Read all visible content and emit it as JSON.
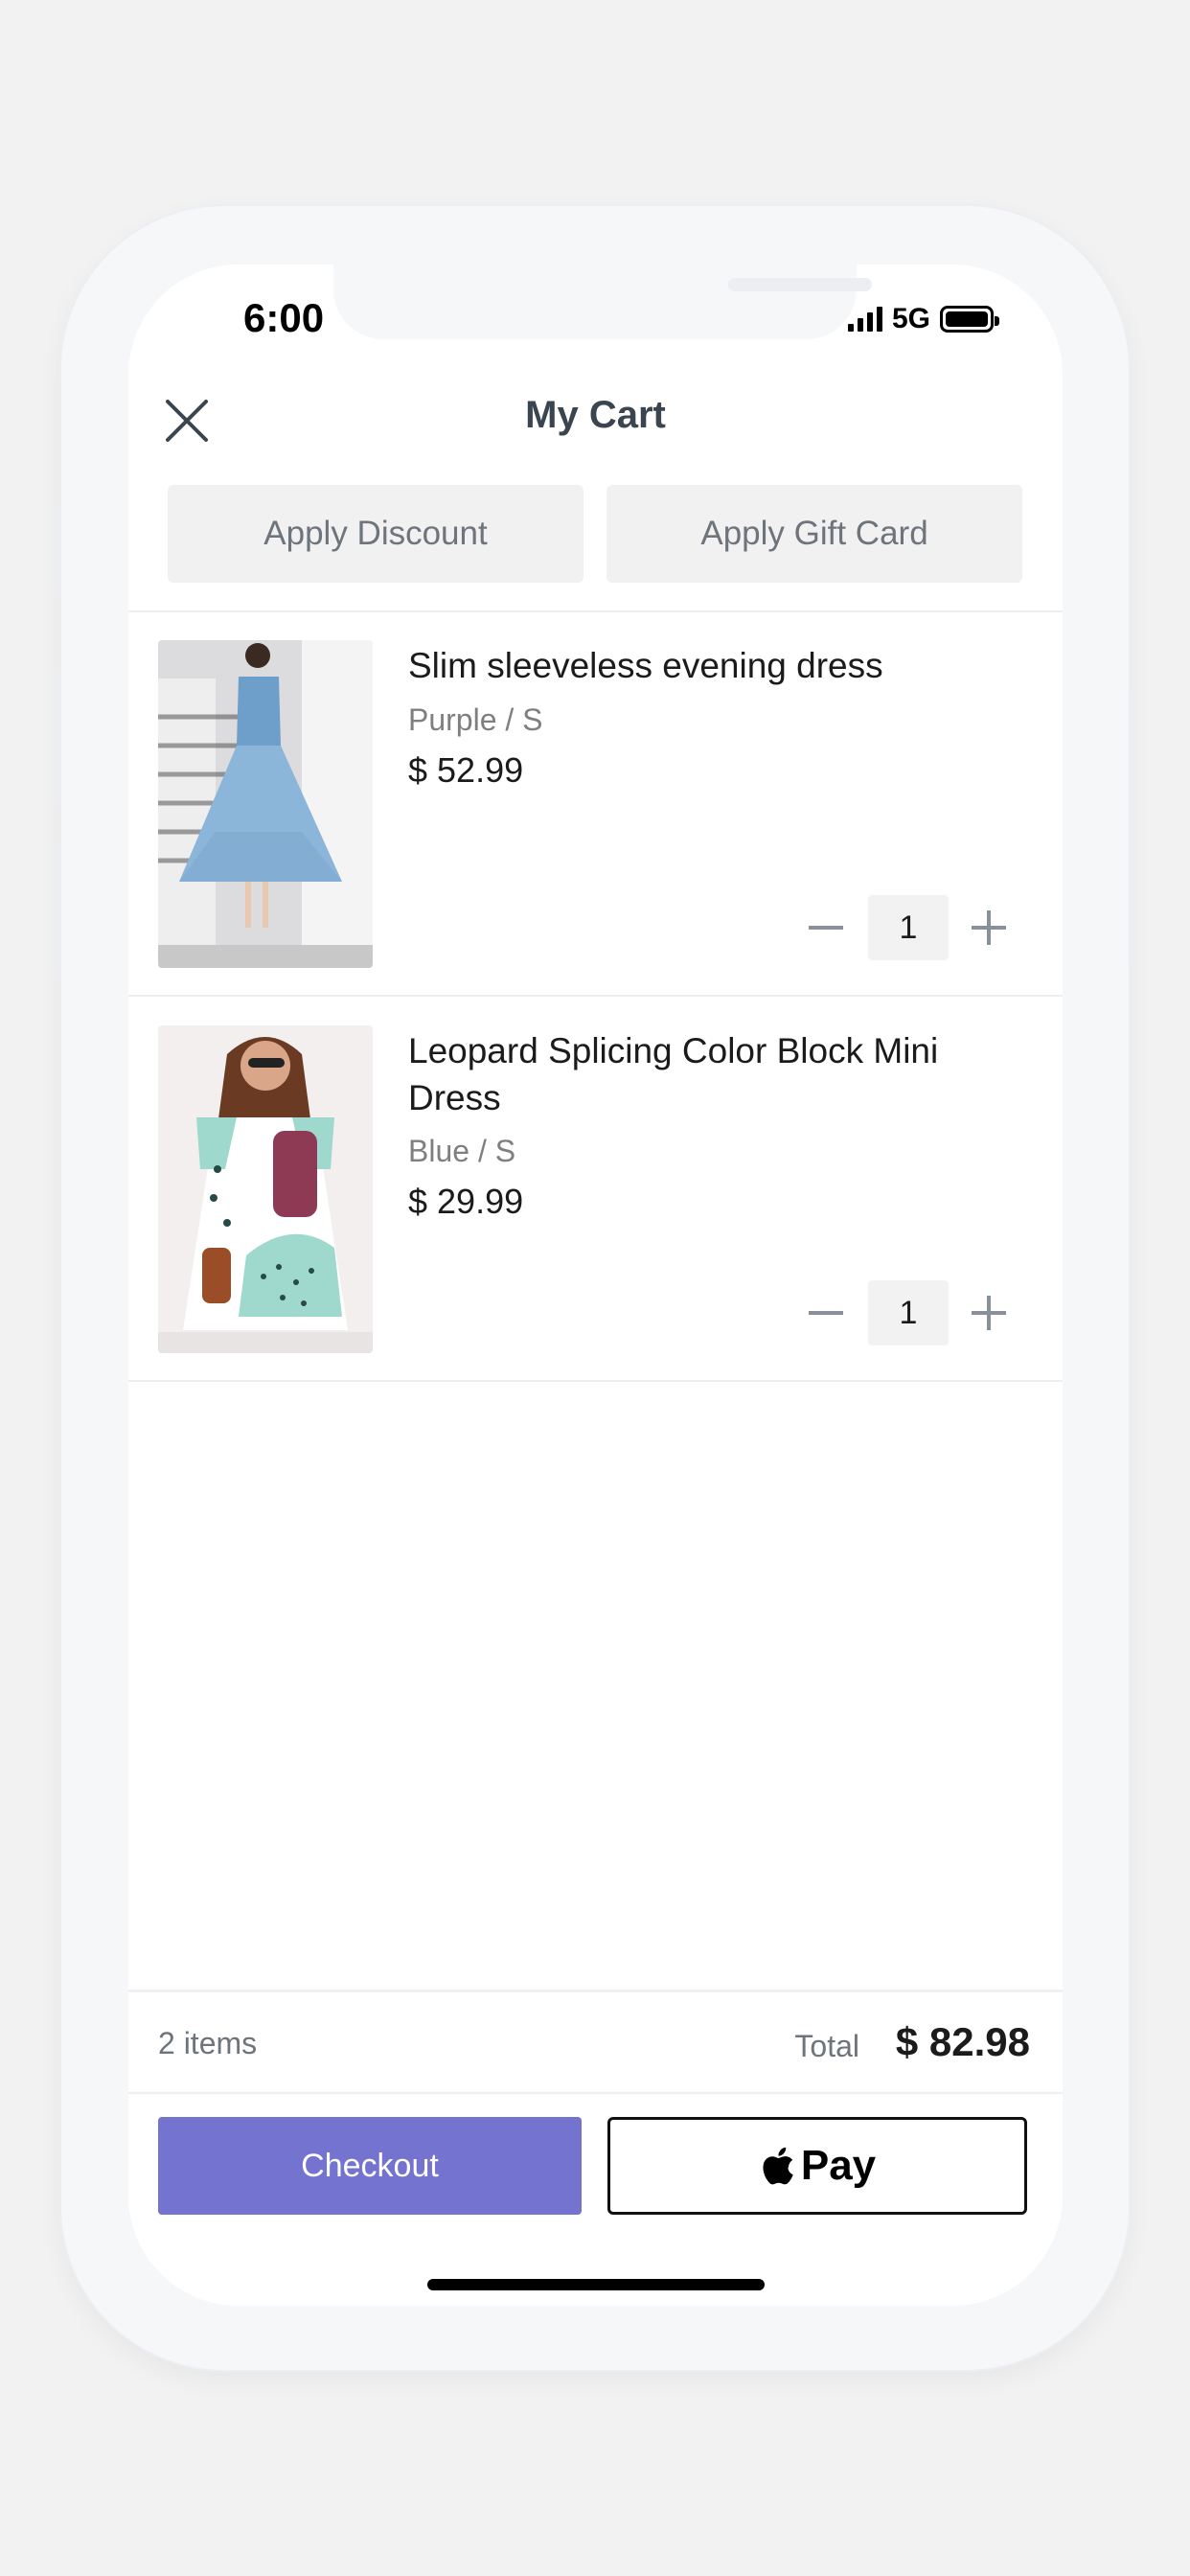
{
  "status_bar": {
    "time": "6:00",
    "network": "5G"
  },
  "header": {
    "title": "My Cart"
  },
  "actions": {
    "discount_label": "Apply Discount",
    "gift_card_label": "Apply Gift Card"
  },
  "cart": {
    "items": [
      {
        "name": "Slim sleeveless evening dress",
        "variant": "Purple / S",
        "price": "$ 52.99",
        "quantity": "1"
      },
      {
        "name": "Leopard Splicing Color Block Mini Dress",
        "variant": "Blue / S",
        "price": "$ 29.99",
        "quantity": "1"
      }
    ]
  },
  "footer": {
    "items_count": "2 items",
    "total_label": "Total",
    "total_value": "$ 82.98",
    "checkout_label": "Checkout",
    "applepay_label": "Pay"
  },
  "colors": {
    "accent": "#7474d0",
    "background": "#f2f2f3",
    "text": "#1b1b1b"
  }
}
